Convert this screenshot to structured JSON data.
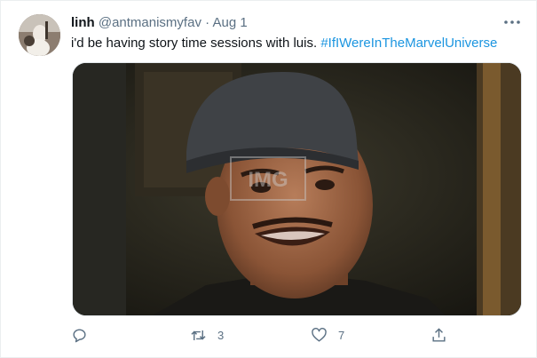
{
  "tweet": {
    "author": {
      "name": "linh",
      "handle": "@antmanismyfav",
      "avatar_icon": "profile-photo"
    },
    "separator": "·",
    "date": "Aug 1",
    "text": "i'd be having story time sessions with luis.",
    "hashtag": "#IfIWereInTheMarvelUniverse",
    "media": {
      "description_icon": "gif-still-man-in-cap",
      "watermark": "IMG"
    },
    "actions": {
      "reply": {
        "icon": "reply-icon",
        "count": ""
      },
      "retweet": {
        "icon": "retweet-icon",
        "count": "3"
      },
      "like": {
        "icon": "heart-icon",
        "count": "7"
      },
      "share": {
        "icon": "share-icon",
        "count": ""
      }
    }
  },
  "colors": {
    "text": "#0f1419",
    "secondary": "#5b7083",
    "link": "#1b95e0",
    "border": "#ebeef0"
  }
}
